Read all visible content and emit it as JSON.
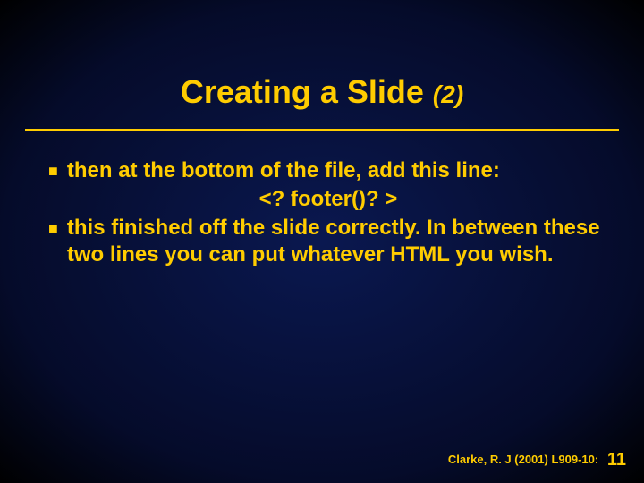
{
  "title": {
    "main": "Creating a Slide ",
    "sub": "(2)"
  },
  "bullets": [
    "then at the bottom of the file, add this line:",
    "this finished off the slide correctly. In between these two lines you can put whatever HTML you wish."
  ],
  "code": "<? footer()? >",
  "footer": {
    "citation": "Clarke, R. J (2001) L909-10:",
    "page": "11"
  }
}
